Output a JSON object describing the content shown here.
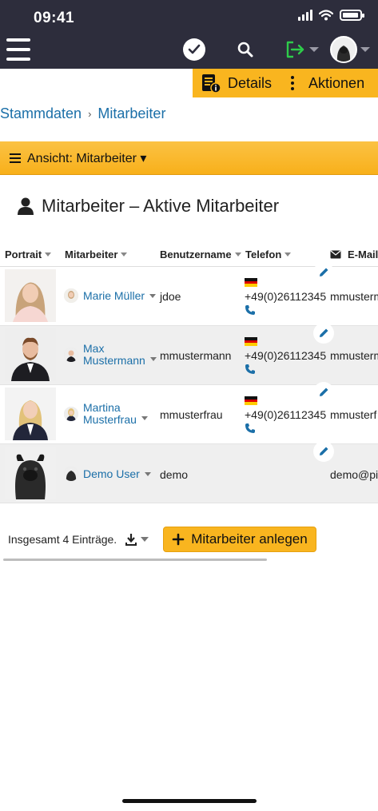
{
  "status": {
    "time": "09:41"
  },
  "nav": {
    "menu_icon": "hamburger-icon",
    "icons": [
      "check-circle-icon",
      "search-icon",
      "logout-icon",
      "avatar"
    ]
  },
  "actionbar": {
    "details_label": "Details",
    "actions_label": "Aktionen"
  },
  "breadcrumb": {
    "root": "Stammdaten",
    "current": "Mitarbeiter"
  },
  "view": {
    "label": "Ansicht: Mitarbeiter ▾"
  },
  "page": {
    "title": "Mitarbeiter – Aktive Mitarbeiter"
  },
  "table": {
    "columns": [
      "Portrait",
      "Mitarbeiter",
      "Benutzername",
      "Telefon",
      "E-Mail"
    ],
    "rows": [
      {
        "name_line1": "Marie Müller",
        "name_line2": "",
        "username": "jdoe",
        "phone": "+49(0)26112345",
        "email": "mmusterm",
        "has_phone": true
      },
      {
        "name_line1": "Max",
        "name_line2": "Mustermann",
        "username": "mmustermann",
        "phone": "+49(0)26112345",
        "email": "mmusterm",
        "has_phone": true
      },
      {
        "name_line1": "Martina",
        "name_line2": "Musterfrau",
        "username": "mmusterfrau",
        "phone": "+49(0)26112345",
        "email": "mmusterf",
        "has_phone": true
      },
      {
        "name_line1": "Demo User",
        "name_line2": "",
        "username": "demo",
        "phone": "",
        "email": "demo@pic",
        "has_phone": false
      }
    ]
  },
  "footer": {
    "total": "Insgesamt 4 Einträge.",
    "add_label": "Mitarbeiter anlegen"
  },
  "colors": {
    "topbar": "#2d2d3c",
    "accent": "#f9b51f",
    "link": "#1b6fa8",
    "logout_green": "#2ecc4a"
  }
}
